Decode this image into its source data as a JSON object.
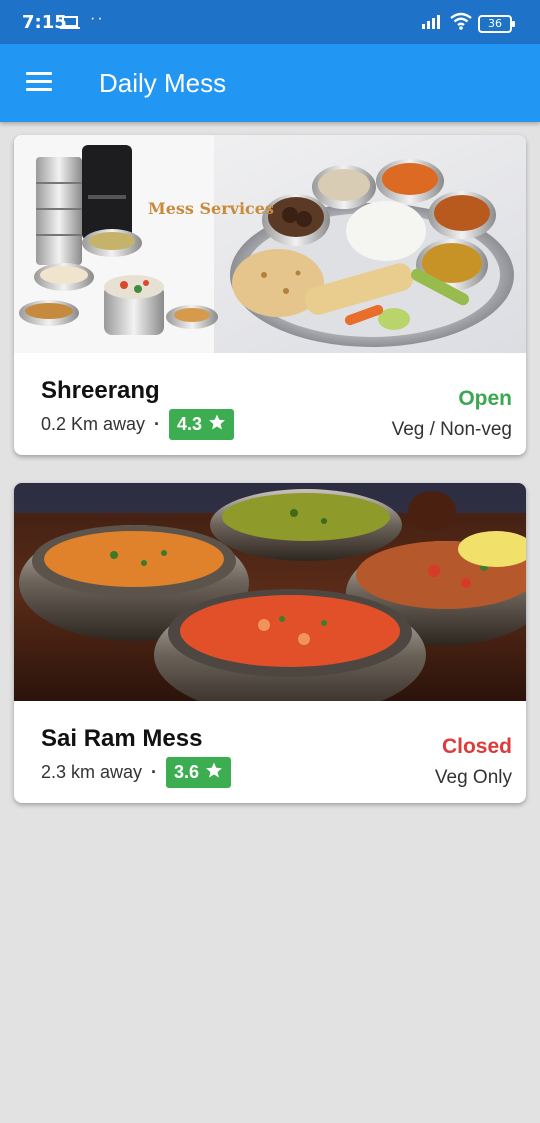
{
  "status_bar": {
    "time": "7:15",
    "battery": "36"
  },
  "app_bar": {
    "title": "Daily Mess"
  },
  "messes": [
    {
      "banner_text": "Mess Services",
      "name": "Shreerang",
      "distance": "0.2 Km away",
      "separator": "·",
      "rating": "4.3",
      "status": "Open",
      "food_type": "Veg / Non-veg"
    },
    {
      "name": "Sai Ram Mess",
      "distance": "2.3 km away",
      "separator": "·",
      "rating": "3.6",
      "status": "Closed",
      "food_type": "Veg Only"
    }
  ],
  "colors": {
    "app_bar": "#2196f3",
    "status_bar": "#1e73c9",
    "open": "#3ba850",
    "closed": "#dd3b3b",
    "rating": "#3cae51"
  }
}
